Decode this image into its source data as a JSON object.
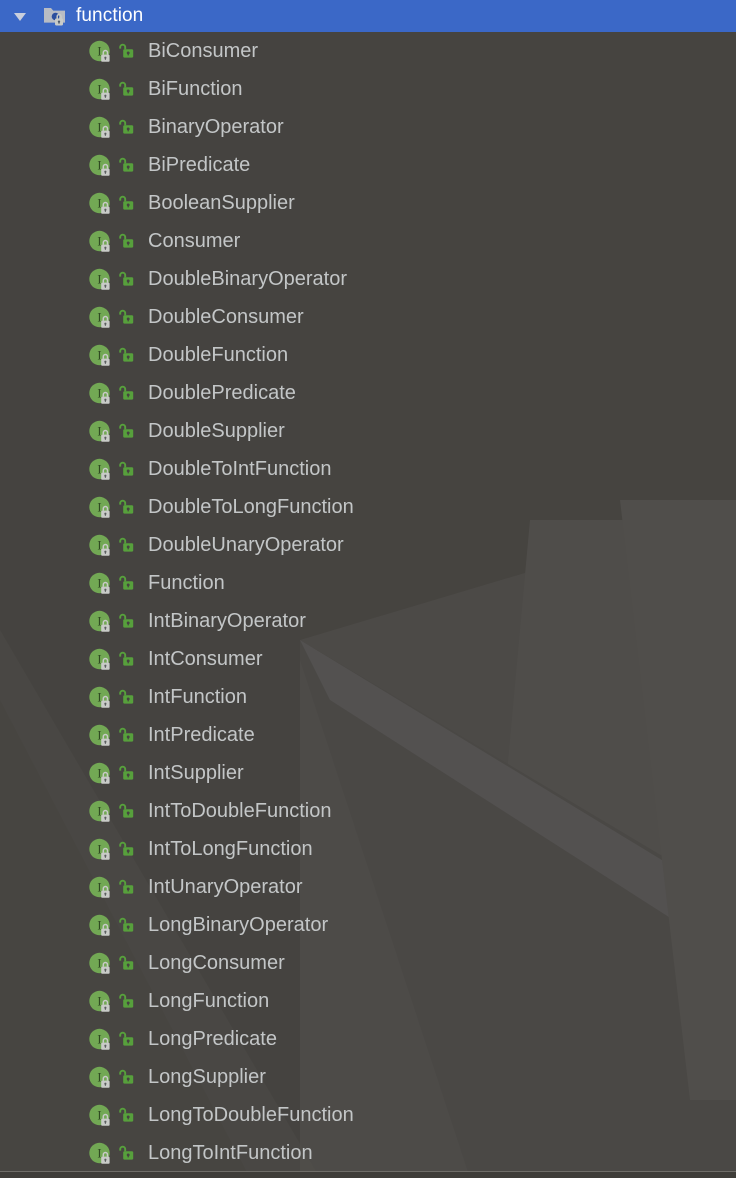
{
  "colors": {
    "selection_blue": "#3b68c7",
    "background": "#464440",
    "text": "#c3c6c7",
    "header_text": "#ffffff",
    "interface_green": "#72a854",
    "visibility_green": "#57a03c",
    "lock_gray": "#c9cbc8",
    "separator": "#6f6d68"
  },
  "header": {
    "expand_state": "expanded",
    "twisty_icon": "triangle-down-icon",
    "package_icon": "package-locked-icon",
    "title": "function"
  },
  "tree": {
    "item_icon": "interface-locked-icon",
    "visibility_icon": "unlocked-padlock-icon",
    "items": [
      {
        "label": "BiConsumer"
      },
      {
        "label": "BiFunction"
      },
      {
        "label": "BinaryOperator"
      },
      {
        "label": "BiPredicate"
      },
      {
        "label": "BooleanSupplier"
      },
      {
        "label": "Consumer"
      },
      {
        "label": "DoubleBinaryOperator"
      },
      {
        "label": "DoubleConsumer"
      },
      {
        "label": "DoubleFunction"
      },
      {
        "label": "DoublePredicate"
      },
      {
        "label": "DoubleSupplier"
      },
      {
        "label": "DoubleToIntFunction"
      },
      {
        "label": "DoubleToLongFunction"
      },
      {
        "label": "DoubleUnaryOperator"
      },
      {
        "label": "Function"
      },
      {
        "label": "IntBinaryOperator"
      },
      {
        "label": "IntConsumer"
      },
      {
        "label": "IntFunction"
      },
      {
        "label": "IntPredicate"
      },
      {
        "label": "IntSupplier"
      },
      {
        "label": "IntToDoubleFunction"
      },
      {
        "label": "IntToLongFunction"
      },
      {
        "label": "IntUnaryOperator"
      },
      {
        "label": "LongBinaryOperator"
      },
      {
        "label": "LongConsumer"
      },
      {
        "label": "LongFunction"
      },
      {
        "label": "LongPredicate"
      },
      {
        "label": "LongSupplier"
      },
      {
        "label": "LongToDoubleFunction"
      },
      {
        "label": "LongToIntFunction"
      }
    ]
  }
}
